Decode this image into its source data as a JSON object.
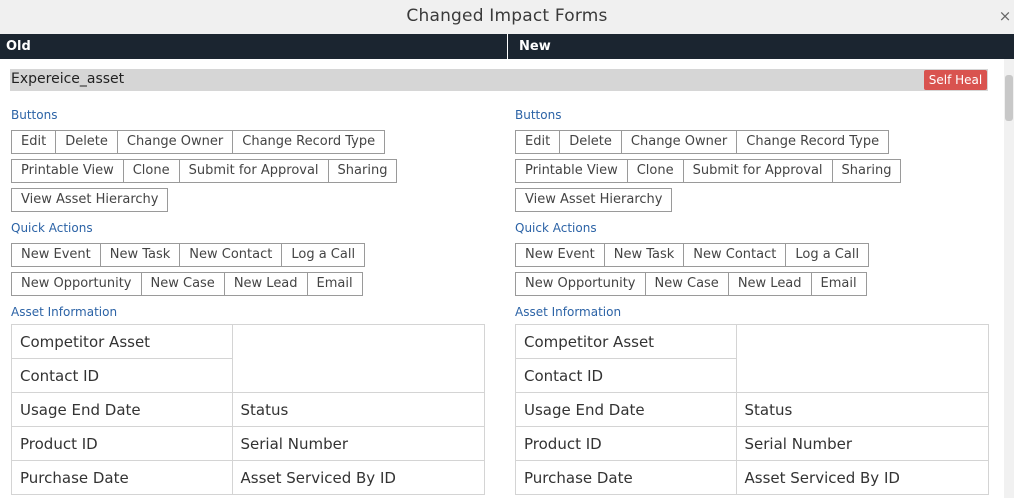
{
  "dialog": {
    "title": "Changed Impact Forms",
    "close_glyph": "×"
  },
  "columns": {
    "old": "Old",
    "new": "New"
  },
  "asset": {
    "name": "Expereice_asset",
    "self_heal_label": "Self Heal"
  },
  "panels": {
    "old": {
      "buttons_heading": "Buttons",
      "buttons": [
        "Edit",
        "Delete",
        "Change Owner",
        "Change Record Type",
        "Printable View",
        "Clone",
        "Submit for Approval",
        "Sharing",
        "View Asset Hierarchy"
      ],
      "quick_actions_heading": "Quick Actions",
      "quick_actions": [
        "New Event",
        "New Task",
        "New Contact",
        "Log a Call",
        "New Opportunity",
        "New Case",
        "New Lead",
        "Email"
      ],
      "info_heading": "Asset Information",
      "fields": [
        "Competitor Asset",
        "Contact ID",
        "Usage End Date",
        "Status",
        "Product ID",
        "Serial Number",
        "Purchase Date",
        "Asset Serviced By ID"
      ]
    },
    "new": {
      "buttons_heading": "Buttons",
      "buttons": [
        "Edit",
        "Delete",
        "Change Owner",
        "Change Record Type",
        "Printable View",
        "Clone",
        "Submit for Approval",
        "Sharing",
        "View Asset Hierarchy"
      ],
      "quick_actions_heading": "Quick Actions",
      "quick_actions": [
        "New Event",
        "New Task",
        "New Contact",
        "Log a Call",
        "New Opportunity",
        "New Case",
        "New Lead",
        "Email"
      ],
      "info_heading": "Asset Information",
      "fields": [
        "Competitor Asset",
        "Contact ID",
        "Usage End Date",
        "Status",
        "Product ID",
        "Serial Number",
        "Purchase Date",
        "Asset Serviced By ID"
      ]
    }
  }
}
